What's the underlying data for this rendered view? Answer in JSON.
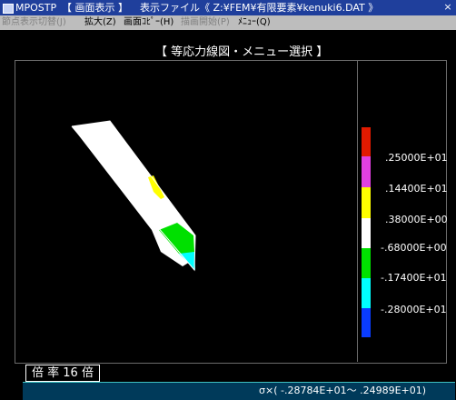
{
  "window": {
    "app_title": "MPOSTP",
    "mode": "【 画面表示 】",
    "file_label": "表示ファイル《 Z:¥FEM¥有限要素¥kenuki6.DAT 》",
    "close_glyph": "×"
  },
  "menu": {
    "items": [
      {
        "label": "節点表示切替(J)",
        "enabled": false
      },
      {
        "label": "拡大(Z)",
        "enabled": true
      },
      {
        "label": "画面ｺﾋﾟｰ(H)",
        "enabled": true
      },
      {
        "label": "描画開始(P)",
        "enabled": false
      },
      {
        "label": "ﾒﾆｭｰ(Q)",
        "enabled": true
      }
    ]
  },
  "panel": {
    "title": "【 等応力線図・メニュー選択 】"
  },
  "legend": {
    "colors": [
      "#e01a00",
      "#e040e0",
      "#ffff00",
      "#ffffff",
      "#00e000",
      "#00ffff",
      "#0a3cff"
    ],
    "labels": [
      ".25000E+01",
      ".14400E+01",
      ".38000E+00",
      "-.68000E+00",
      "-.17400E+01",
      "-.28000E+01"
    ]
  },
  "status": {
    "scale_label": "倍 率 16 倍",
    "range_label": "σ×( -.28784E+01～  .24989E+01)"
  }
}
